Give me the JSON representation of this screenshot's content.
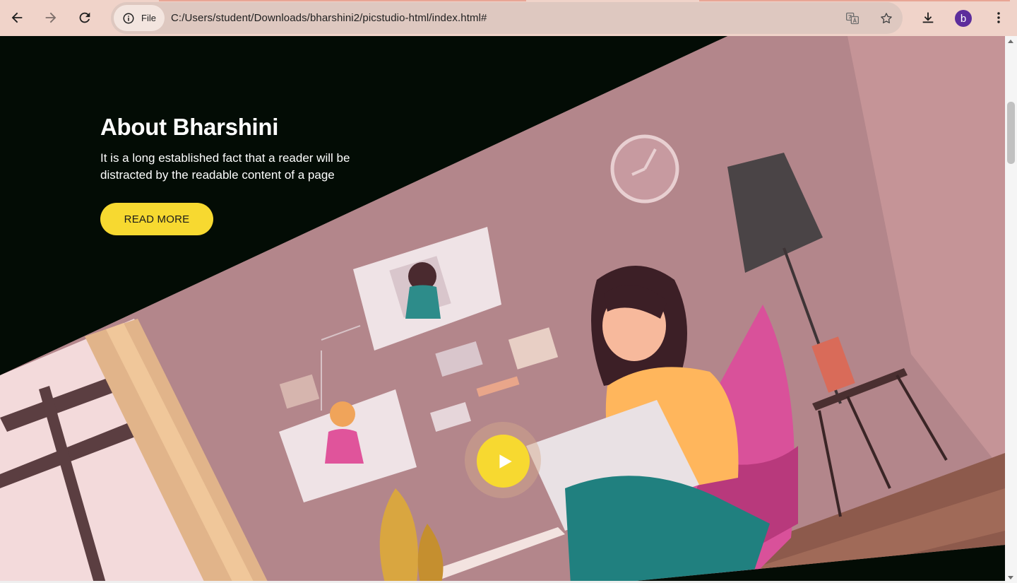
{
  "browser": {
    "site_chip_label": "File",
    "url": "C:/Users/student/Downloads/bharshini2/picstudio-html/index.html#",
    "profile_initial": "b",
    "icons": [
      "back-arrow-icon",
      "forward-arrow-icon",
      "reload-icon",
      "info-icon",
      "translate-icon",
      "star-icon",
      "download-icon",
      "kebab-menu-icon"
    ]
  },
  "about": {
    "title": "About Bharshini",
    "text": "It is a long established fact that a reader will be distracted by the readable content of a page",
    "button_label": "READ MORE"
  },
  "colors": {
    "page_background": "#030c05",
    "accent_yellow": "#f7d930",
    "chrome_background": "#f0d3c9",
    "illustration_wall": "#b3868b"
  }
}
